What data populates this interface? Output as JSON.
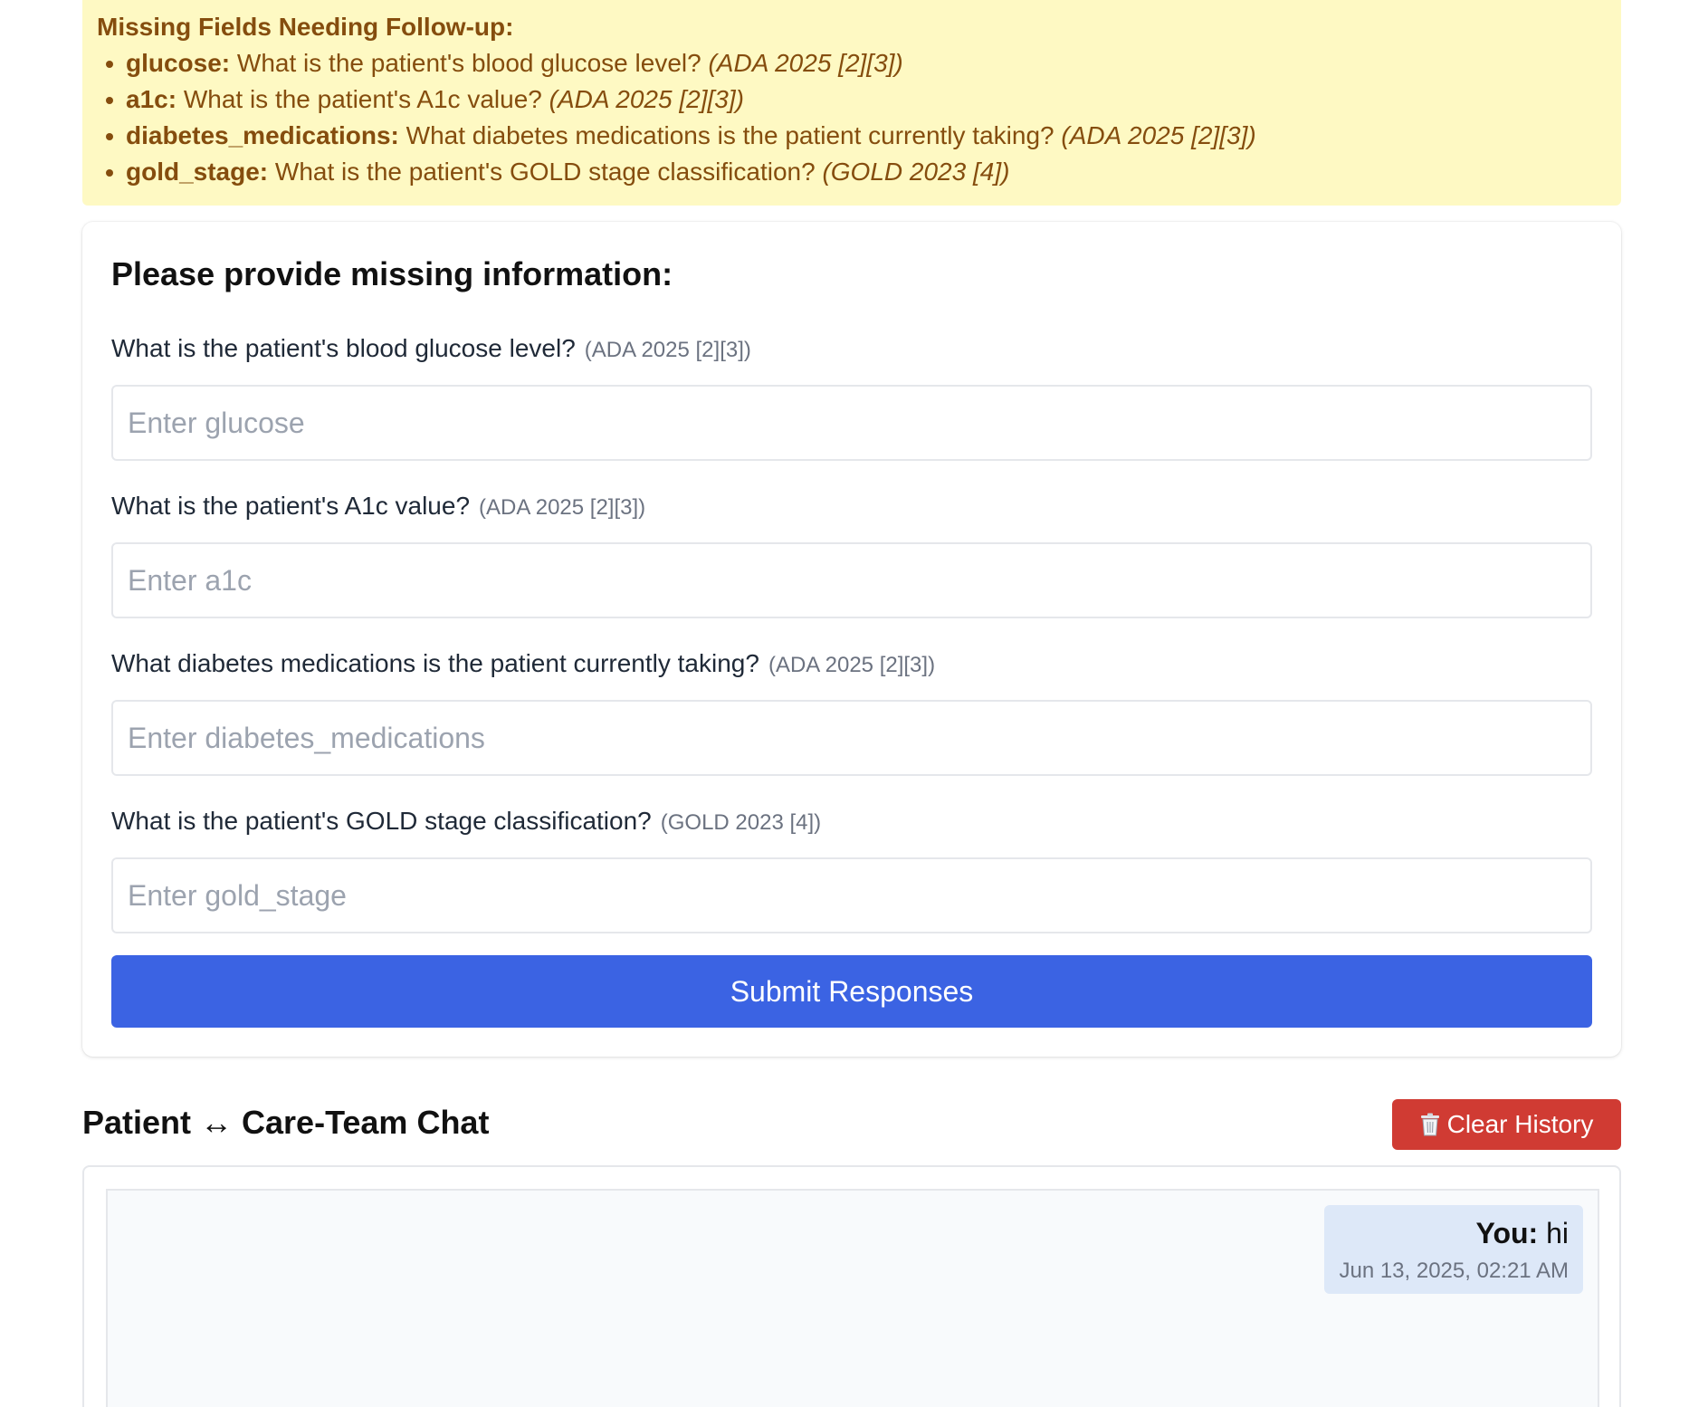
{
  "missing": {
    "title": "Missing Fields Needing Follow-up:",
    "items": [
      {
        "key": "glucose:",
        "question": "What is the patient's blood glucose level?",
        "cite": "(ADA 2025 [2][3])"
      },
      {
        "key": "a1c:",
        "question": "What is the patient's A1c value?",
        "cite": "(ADA 2025 [2][3])"
      },
      {
        "key": "diabetes_medications:",
        "question": "What diabetes medications is the patient currently taking?",
        "cite": "(ADA 2025 [2][3])"
      },
      {
        "key": "gold_stage:",
        "question": "What is the patient's GOLD stage classification?",
        "cite": "(GOLD 2023 [4])"
      }
    ],
    "colors": {
      "background": "#fef9c3",
      "text": "#854d0e"
    }
  },
  "form": {
    "title": "Please provide missing information:",
    "fields": [
      {
        "label": "What is the patient's blood glucose level?",
        "cite": "(ADA 2025 [2][3])",
        "placeholder": "Enter glucose",
        "value": ""
      },
      {
        "label": "What is the patient's A1c value?",
        "cite": "(ADA 2025 [2][3])",
        "placeholder": "Enter a1c",
        "value": ""
      },
      {
        "label": "What diabetes medications is the patient currently taking?",
        "cite": "(ADA 2025 [2][3])",
        "placeholder": "Enter diabetes_medications",
        "value": ""
      },
      {
        "label": "What is the patient's GOLD stage classification?",
        "cite": "(GOLD 2023 [4])",
        "placeholder": "Enter gold_stage",
        "value": ""
      }
    ],
    "submit_label": "Submit Responses",
    "submit_color": "#3b63e3"
  },
  "chat": {
    "title": "Patient ↔ Care-Team Chat",
    "clear_label": "Clear History",
    "clear_icon": "trash-icon",
    "clear_color": "#d03b33",
    "messages": [
      {
        "sender": "You:",
        "text": "hi",
        "timestamp": "Jun 13, 2025, 02:21 AM"
      }
    ]
  }
}
